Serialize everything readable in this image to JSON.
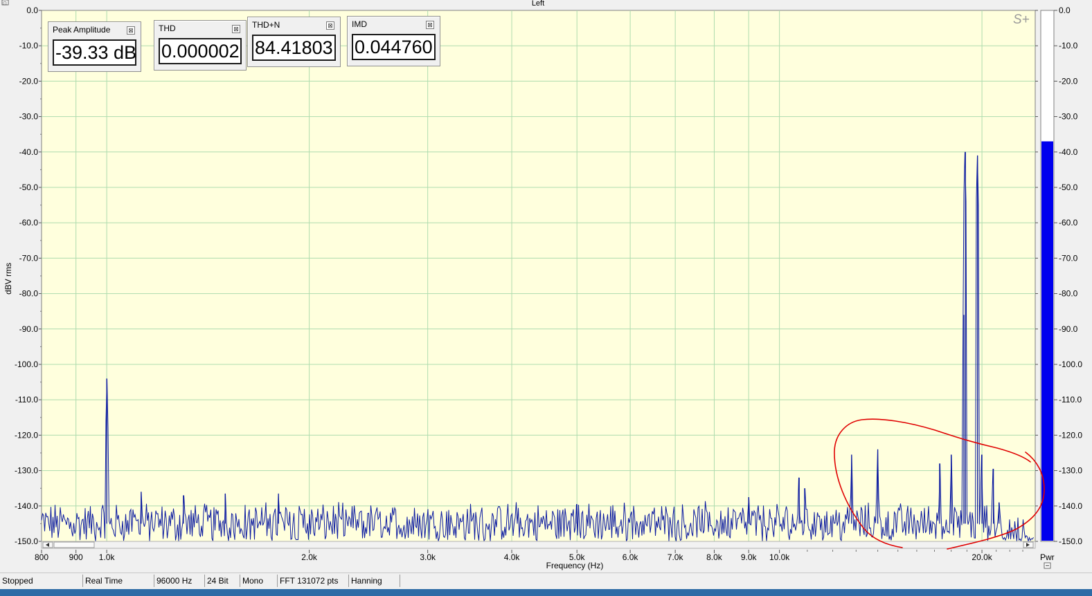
{
  "window": {
    "title": "Left",
    "corner_glyph": "⊡",
    "collapse_glyph": "−"
  },
  "plot": {
    "ylabel": "dBV rms",
    "xlabel": "Frequency (Hz)",
    "logo": "S+",
    "y_ticks": [
      "0.0",
      "-10.0",
      "-20.0",
      "-30.0",
      "-40.0",
      "-50.0",
      "-60.0",
      "-70.0",
      "-80.0",
      "-90.0",
      "-100.0",
      "-110.0",
      "-120.0",
      "-130.0",
      "-140.0",
      "-150.0"
    ],
    "x_ticks": [
      {
        "f": 800,
        "label": "800"
      },
      {
        "f": 900,
        "label": "900"
      },
      {
        "f": 1000,
        "label": "1.0k"
      },
      {
        "f": 2000,
        "label": "2.0k"
      },
      {
        "f": 3000,
        "label": "3.0k"
      },
      {
        "f": 4000,
        "label": "4.0k"
      },
      {
        "f": 5000,
        "label": "5.0k"
      },
      {
        "f": 6000,
        "label": "6.0k"
      },
      {
        "f": 7000,
        "label": "7.0k"
      },
      {
        "f": 8000,
        "label": "8.0k"
      },
      {
        "f": 9000,
        "label": "9.0k"
      },
      {
        "f": 10000,
        "label": "10.0k"
      },
      {
        "f": 20000,
        "label": "20.0k"
      }
    ],
    "colors": {
      "background": "#ffffdd",
      "grid": "#aedcae",
      "trace": "#0b1aa0",
      "meter_fill": "#0000ee",
      "annotation": "#e00000"
    }
  },
  "chart_data": {
    "type": "line",
    "title": "Left",
    "xlabel": "Frequency (Hz)",
    "ylabel": "dBV rms",
    "x_scale": "log",
    "xlim": [
      800,
      24000
    ],
    "ylim": [
      -150,
      0
    ],
    "grid": true,
    "noise_floor_db": -145,
    "peaks": [
      {
        "f": 1000,
        "db": -104
      },
      {
        "f": 1125,
        "db": -136
      },
      {
        "f": 1300,
        "db": -137
      },
      {
        "f": 1500,
        "db": -136.5
      },
      {
        "f": 1800,
        "db": -136.5
      },
      {
        "f": 5000,
        "db": -139.5
      },
      {
        "f": 9000,
        "db": -137.5
      },
      {
        "f": 10700,
        "db": -132
      },
      {
        "f": 10900,
        "db": -135
      },
      {
        "f": 12800,
        "db": -125.5
      },
      {
        "f": 14000,
        "db": -124
      },
      {
        "f": 17300,
        "db": -128
      },
      {
        "f": 18000,
        "db": -125.5
      },
      {
        "f": 18800,
        "db": -86
      },
      {
        "f": 18900,
        "db": -40
      },
      {
        "f": 19700,
        "db": -41
      },
      {
        "f": 20000,
        "db": -125.5
      },
      {
        "f": 20800,
        "db": -129.5
      },
      {
        "f": 21200,
        "db": -139
      }
    ],
    "power_meter": {
      "label": "Pwr",
      "level_db": -37,
      "scale": [
        "0.0",
        "-10.0",
        "-20.0",
        "-30.0",
        "-40.0",
        "-50.0",
        "-60.0",
        "-70.0",
        "-80.0",
        "-90.0",
        "-100.0",
        "-110.0",
        "-120.0",
        "-130.0",
        "-140.0",
        "-150.0"
      ]
    }
  },
  "meters": [
    {
      "title": "Peak Amplitude",
      "value": "-39.33 dB"
    },
    {
      "title": "THD",
      "value": "0.000002"
    },
    {
      "title": "THD+N",
      "value": "84.41803"
    },
    {
      "title": "IMD",
      "value": "0.044760"
    }
  ],
  "meter_close_glyph": "⊠",
  "status": [
    "Stopped",
    "Real Time",
    "96000 Hz",
    "24 Bit",
    "Mono",
    "FFT 131072 pts",
    "Hanning"
  ]
}
